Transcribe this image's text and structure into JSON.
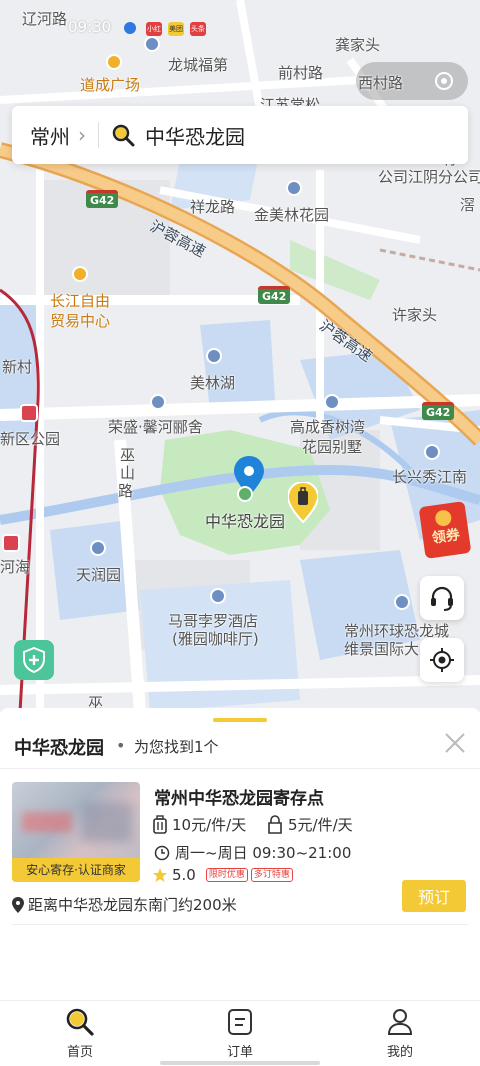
{
  "status_bar": {
    "time": "09:30",
    "app_icons": [
      "小红书",
      "美团",
      "头条"
    ]
  },
  "search": {
    "city": "常州",
    "query": "中华恐龙园"
  },
  "map": {
    "labels": {
      "liaohe_road": "辽河路",
      "gongjiatou": "龚家头",
      "longcheng_fudi": "龙城福第",
      "daocheng_plaza": "道成广场",
      "qiancun_road": "前村路",
      "xicun_road": "西村路",
      "jiangsu_partial": "江苏常松",
      "company": "公司江阴分公司",
      "you": "有",
      "se": "滘",
      "xianglong_road": "祥龙路",
      "jinmeilin_garden": "金美林花园",
      "hurong_expressway_1": "沪蓉高速",
      "hurong_expressway_2": "沪蓉高速",
      "g42_1": "G42",
      "g42_2": "G42",
      "g42_3": "G42",
      "changjiang_ftz": "长江自由",
      "trade_center": "贸易中心",
      "xujiatou": "许家头",
      "xincun": "新村",
      "meilinhu": "美林湖",
      "xinqu_park": "新区公园",
      "rongsheng": "荣盛·馨河郦舍",
      "gaocheng": "高成香树湾",
      "gaocheng_villa": "花园别墅",
      "changxing": "长兴秀江南",
      "wushan_road_1": "巫",
      "wushan_road_2": "山",
      "wushan_road_3": "路",
      "dinosaur_park": "中华恐龙园",
      "hehai": "河海",
      "tianrun_garden": "天润园",
      "marco_polo": "马哥孛罗酒店",
      "marco_polo_cafe": "(雅园咖啡厅)",
      "global_dino_city": "常州环球恐龙城",
      "weijing_intl": "维景国际大",
      "wu_bottom": "巫"
    },
    "coupon_label": "领券"
  },
  "sheet": {
    "title": "中华恐龙园",
    "count_text": "为您找到1个",
    "store": {
      "name": "常州中华恐龙园寄存点",
      "thumb_tag": "安心寄存·认证商家",
      "price_large": "10元/件/天",
      "price_small": "5元/件/天",
      "hours": "周一~周日 09:30~21:00",
      "rating": "5.0",
      "badges": [
        "限时优惠",
        "多订特惠"
      ],
      "distance": "距离中华恐龙园东南门约200米",
      "book_label": "预订"
    }
  },
  "tabs": [
    {
      "label": "首页",
      "icon": "search-icon"
    },
    {
      "label": "订单",
      "icon": "order-icon"
    },
    {
      "label": "我的",
      "icon": "profile-icon"
    }
  ],
  "colors": {
    "accent": "#f3c936",
    "map_bg": "#eceef1",
    "water": "#c8dbf3",
    "park": "#c7e9c0",
    "expressway": "#f2b768",
    "shield_green": "#4cc59a"
  }
}
